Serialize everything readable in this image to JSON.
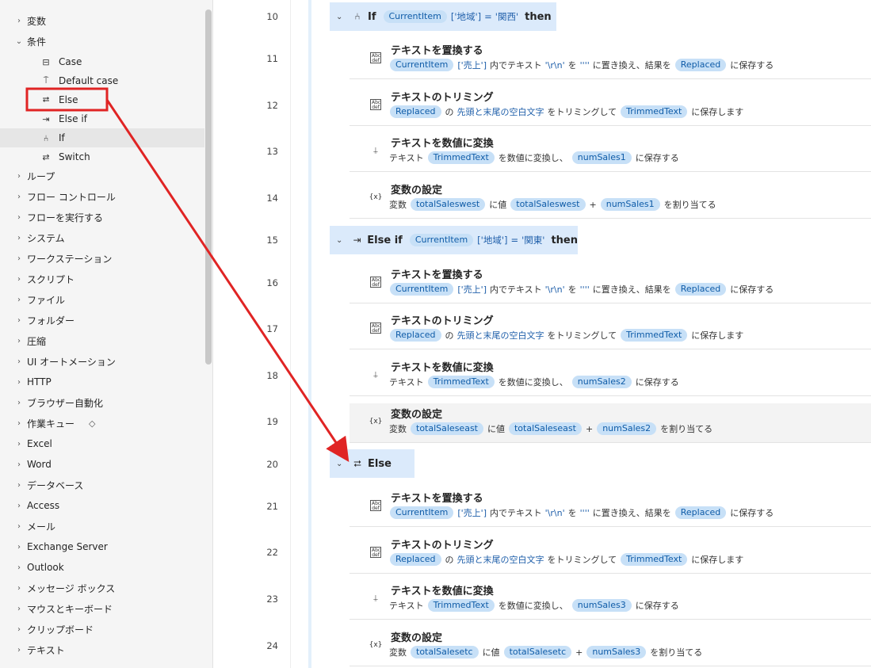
{
  "sidebar": {
    "items": [
      {
        "label": "変数",
        "type": "group",
        "expanded": false
      },
      {
        "label": "条件",
        "type": "group",
        "expanded": true
      },
      {
        "label": "Case",
        "type": "child",
        "icon": "case-icon"
      },
      {
        "label": "Default case",
        "type": "child",
        "icon": "default-case-icon"
      },
      {
        "label": "Else",
        "type": "child",
        "icon": "else-icon"
      },
      {
        "label": "Else if",
        "type": "child",
        "icon": "else-if-icon"
      },
      {
        "label": "If",
        "type": "child",
        "icon": "if-icon",
        "selected": true
      },
      {
        "label": "Switch",
        "type": "child",
        "icon": "switch-icon"
      },
      {
        "label": "ループ",
        "type": "group"
      },
      {
        "label": "フロー コントロール",
        "type": "group"
      },
      {
        "label": "フローを実行する",
        "type": "group"
      },
      {
        "label": "システム",
        "type": "group"
      },
      {
        "label": "ワークステーション",
        "type": "group"
      },
      {
        "label": "スクリプト",
        "type": "group"
      },
      {
        "label": "ファイル",
        "type": "group"
      },
      {
        "label": "フォルダー",
        "type": "group"
      },
      {
        "label": "圧縮",
        "type": "group"
      },
      {
        "label": "UI オートメーション",
        "type": "group"
      },
      {
        "label": "HTTP",
        "type": "group"
      },
      {
        "label": "ブラウザー自動化",
        "type": "group"
      },
      {
        "label": "作業キュー",
        "type": "group",
        "premium": true
      },
      {
        "label": "Excel",
        "type": "group"
      },
      {
        "label": "Word",
        "type": "group"
      },
      {
        "label": "データベース",
        "type": "group"
      },
      {
        "label": "Access",
        "type": "group"
      },
      {
        "label": "メール",
        "type": "group"
      },
      {
        "label": "Exchange Server",
        "type": "group"
      },
      {
        "label": "Outlook",
        "type": "group"
      },
      {
        "label": "メッセージ ボックス",
        "type": "group"
      },
      {
        "label": "マウスとキーボード",
        "type": "group"
      },
      {
        "label": "クリップボード",
        "type": "group"
      },
      {
        "label": "テキスト",
        "type": "group"
      }
    ]
  },
  "line_numbers": [
    "10",
    "11",
    "12",
    "13",
    "14",
    "15",
    "16",
    "17",
    "18",
    "19",
    "20",
    "21",
    "22",
    "23",
    "24"
  ],
  "blocks": {
    "if": {
      "keyword": "If",
      "var": "CurrentItem",
      "key": "['地域']",
      "op": "=",
      "value": "'関西'",
      "then": "then"
    },
    "elseif": {
      "keyword": "Else if",
      "var": "CurrentItem",
      "key": "['地域']",
      "op": "=",
      "value": "'関東'",
      "then": "then"
    },
    "else": {
      "keyword": "Else"
    }
  },
  "actions": {
    "replace": {
      "title": "テキストを置換する",
      "var": "CurrentItem",
      "key": "['売上']",
      "t1": "内でテキスト",
      "find": "'\\r\\n'",
      "t2": "を",
      "repl": "''''",
      "t3": "に置き換え、結果を",
      "out": "Replaced",
      "t4": "に保存する"
    },
    "trim": {
      "title": "テキストのトリミング",
      "var": "Replaced",
      "t1": "の",
      "mode": "先頭と末尾の空白文字",
      "t2": "をトリミングして",
      "out": "TrimmedText",
      "t3": "に保存します"
    },
    "tonum": {
      "title": "テキストを数値に変換",
      "t0": "テキスト",
      "var": "TrimmedText",
      "t1": "を数値に変換し、",
      "t2": "に保存する"
    },
    "setvar": {
      "title": "変数の設定",
      "t0": "変数",
      "t1": "に値",
      "plus": "+",
      "t2": "を割り当てる"
    }
  },
  "setvars": {
    "west": {
      "target": "totalSaleswest",
      "num": "numSales1"
    },
    "east": {
      "target": "totalSaleseast",
      "num": "numSales2"
    },
    "etc": {
      "target": "totalSalesetc",
      "num": "numSales3"
    }
  },
  "tonums": {
    "a": "numSales1",
    "b": "numSales2",
    "c": "numSales3"
  },
  "colors": {
    "annotation": "#e02424",
    "chip_bg": "#c7e0f7",
    "header_bg": "#dbeafb"
  }
}
